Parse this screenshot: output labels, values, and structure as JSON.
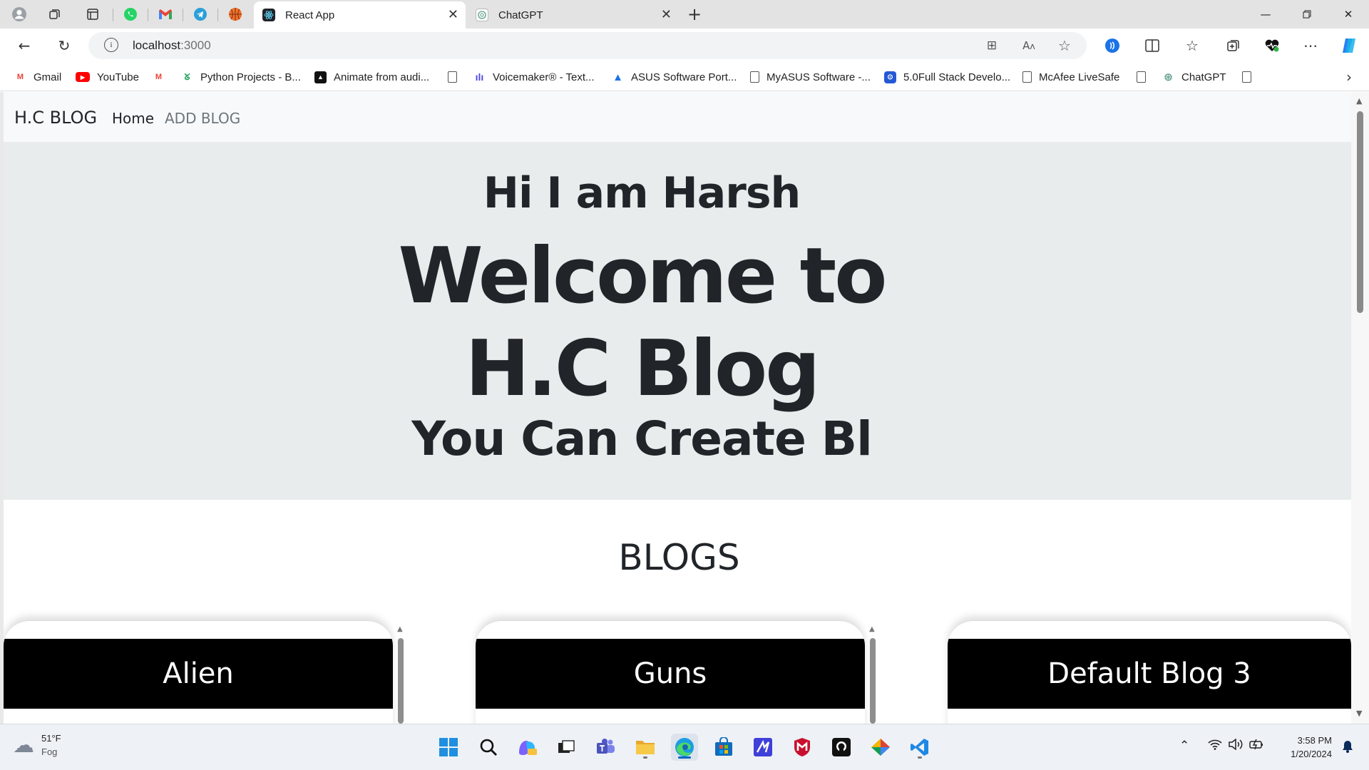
{
  "browser": {
    "tabs": [
      {
        "title": "React App",
        "active": true
      },
      {
        "title": "ChatGPT",
        "active": false
      }
    ],
    "address": {
      "host": "localhost",
      "port": ":3000"
    },
    "bookmarks": [
      "Gmail",
      "YouTube",
      "Python Projects - B...",
      "Animate from audi...",
      "Voicemaker® - Text...",
      "ASUS Software Port...",
      "MyASUS Software -...",
      "5.0Full Stack Develo...",
      "McAfee LiveSafe",
      "ChatGPT"
    ]
  },
  "page": {
    "navbar": {
      "brand": "H.C BLOG",
      "links": [
        "Home",
        "ADD BLOG"
      ]
    },
    "hero": {
      "greeting": "Hi I am Harsh",
      "welcome_line1": "Welcome to",
      "welcome_line2": "H.C Blog",
      "subtitle": "You Can Create Bl"
    },
    "blogs_title": "BLOGS",
    "cards": [
      {
        "title": "Alien"
      },
      {
        "title": "Guns"
      },
      {
        "title": "Default Blog 3"
      }
    ]
  },
  "taskbar": {
    "weather": {
      "temp": "51°F",
      "condition": "Fog"
    },
    "clock": {
      "time": "3:58 PM",
      "date": "1/20/2024"
    }
  },
  "colors": {
    "tabstrip": "#e3e3e3",
    "navbar": "#f8f9fa",
    "hero_bg": "#e9ecec",
    "card_header": "#000000",
    "taskbar": "#eef1f6",
    "accent": "#0067c0"
  }
}
